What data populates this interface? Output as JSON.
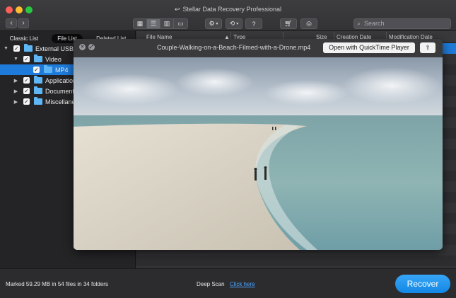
{
  "window": {
    "title": "Stellar Data Recovery Professional"
  },
  "toolbar": {
    "back": "‹",
    "forward": "›",
    "help_label": "?",
    "search_placeholder": "Search"
  },
  "left_panel": {
    "tabs": [
      {
        "label": "Classic List",
        "active": false
      },
      {
        "label": "File List",
        "active": true
      },
      {
        "label": "Deleted List",
        "active": false
      }
    ],
    "tree": [
      {
        "label": "External USB",
        "level": 0,
        "expanded": true,
        "checked": true,
        "selected": false
      },
      {
        "label": "Video",
        "level": 1,
        "expanded": true,
        "checked": true,
        "selected": false
      },
      {
        "label": "MP4",
        "level": 2,
        "expanded": false,
        "checked": true,
        "selected": true
      },
      {
        "label": "Application",
        "level": 1,
        "expanded": false,
        "checked": true,
        "selected": false
      },
      {
        "label": "Documents",
        "level": 1,
        "expanded": false,
        "checked": true,
        "selected": false
      },
      {
        "label": "Miscellaneous",
        "level": 1,
        "expanded": false,
        "checked": true,
        "selected": false
      }
    ]
  },
  "file_list": {
    "columns": [
      "File Name",
      "Type",
      "Size",
      "Creation Date",
      "Modification Date"
    ]
  },
  "preview": {
    "title": "Couple-Walking-on-a-Beach-Filmed-with-a-Drone.mp4",
    "open_button": "Open with QuickTime Player"
  },
  "status": {
    "marked_text": "Marked 59.29 MB in 54 files in 34 folders",
    "deep_scan_label": "Deep Scan",
    "deep_scan_link": "Click here",
    "recover_label": "Recover"
  },
  "colors": {
    "accent": "#1e7bd9",
    "recover": "#2196f3",
    "folder": "#5fb6f4"
  }
}
